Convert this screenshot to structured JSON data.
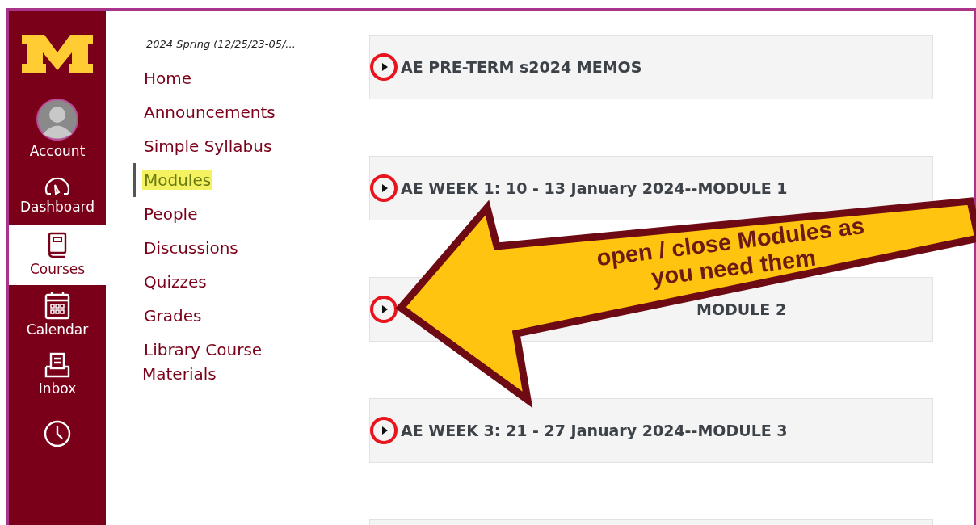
{
  "global_nav": {
    "items": [
      {
        "kind": "account",
        "label": "Account",
        "selected": false
      },
      {
        "kind": "dashboard",
        "label": "Dashboard",
        "selected": false
      },
      {
        "kind": "courses",
        "label": "Courses",
        "selected": true
      },
      {
        "kind": "calendar",
        "label": "Calendar",
        "selected": false
      },
      {
        "kind": "inbox",
        "label": "Inbox",
        "selected": false
      },
      {
        "kind": "history",
        "selected": false
      }
    ]
  },
  "course_nav": {
    "term": "2024 Spring (12/25/23-05/...",
    "items": [
      {
        "label": "Home",
        "selected": false
      },
      {
        "label": "Announcements",
        "selected": false
      },
      {
        "label": "Simple Syllabus",
        "selected": false
      },
      {
        "label": "Modules",
        "selected": true
      },
      {
        "label": "People",
        "selected": false
      },
      {
        "label": "Discussions",
        "selected": false
      },
      {
        "label": "Quizzes",
        "selected": false
      },
      {
        "label": "Grades",
        "selected": false
      },
      {
        "label": "Library Course Materials",
        "selected": false
      }
    ]
  },
  "modules": [
    {
      "title": "AE PRE-TERM s2024 MEMOS",
      "expanded": false,
      "kind": "full"
    },
    {
      "title": "AE WEEK 1: 10 - 13 January 2024--MODULE 1",
      "expanded": false,
      "kind": "full"
    },
    {
      "title": "MODULE 2",
      "expanded": false,
      "kind": "covered"
    },
    {
      "title": "AE WEEK 3: 21 - 27 January 2024--MODULE 3",
      "expanded": false,
      "kind": "full"
    },
    {
      "kind": "cut"
    }
  ],
  "callout": {
    "lines": [
      "open / close Modules as",
      "you need them"
    ]
  }
}
